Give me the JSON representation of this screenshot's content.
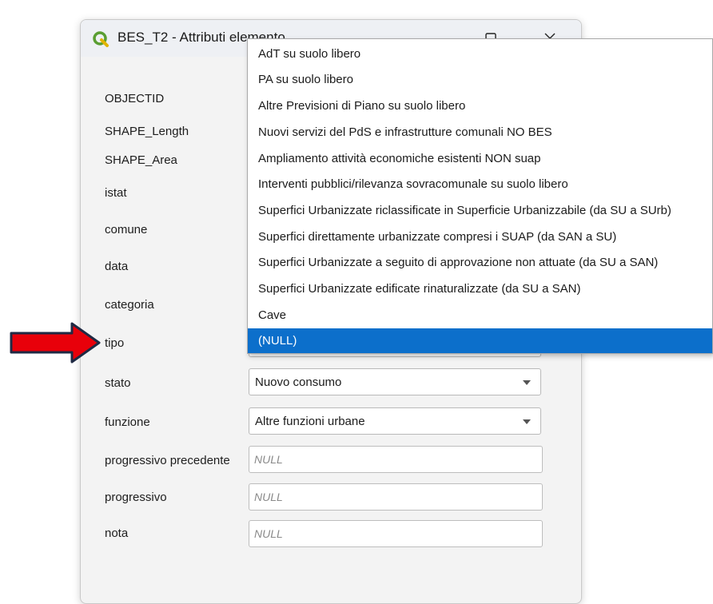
{
  "dialog": {
    "title": "BES_T2 - Attributi elemento",
    "fields": [
      {
        "label": "OBJECTID"
      },
      {
        "label": "SHAPE_Length"
      },
      {
        "label": "SHAPE_Area"
      },
      {
        "label": "istat"
      },
      {
        "label": "comune"
      },
      {
        "label": "data"
      },
      {
        "label": "categoria"
      },
      {
        "label": "tipo"
      },
      {
        "label": "stato",
        "value": "Nuovo consumo"
      },
      {
        "label": "funzione",
        "value": "Altre funzioni urbane"
      },
      {
        "label": "progressivo precedente",
        "placeholder": "NULL"
      },
      {
        "label": "progressivo",
        "placeholder": "NULL"
      },
      {
        "label": "nota",
        "placeholder": "NULL"
      }
    ]
  },
  "dropdown": {
    "options": [
      "AdT su suolo libero",
      "PA su suolo libero",
      "Altre Previsioni di Piano su suolo libero",
      "Nuovi servizi del PdS e infrastrutture comunali NO BES",
      "Ampliamento attività economiche esistenti NON suap",
      "Interventi pubblici/rilevanza sovracomunale su suolo libero",
      "Superfici Urbanizzate riclassificate in Superficie Urbanizzabile (da SU a SUrb)",
      "Superfici direttamente urbanizzate compresi i SUAP (da SAN a SU)",
      "Superfici Urbanizzate a seguito di approvazione non attuate (da SU a SAN)",
      "Superfici Urbanizzate edificate rinaturalizzate (da SU a SAN)",
      "Cave",
      "(NULL)"
    ],
    "selected": "(NULL)"
  },
  "colors": {
    "selection": "#0c6fcb",
    "annotation_arrow": "#e8000a",
    "qgis_green": "#5a9e32"
  },
  "icons": {
    "app": "qgis-logo-icon",
    "maximize": "maximize-icon",
    "close": "close-icon",
    "dropdown": "chevron-down-icon",
    "annotation": "red-arrow-icon"
  }
}
